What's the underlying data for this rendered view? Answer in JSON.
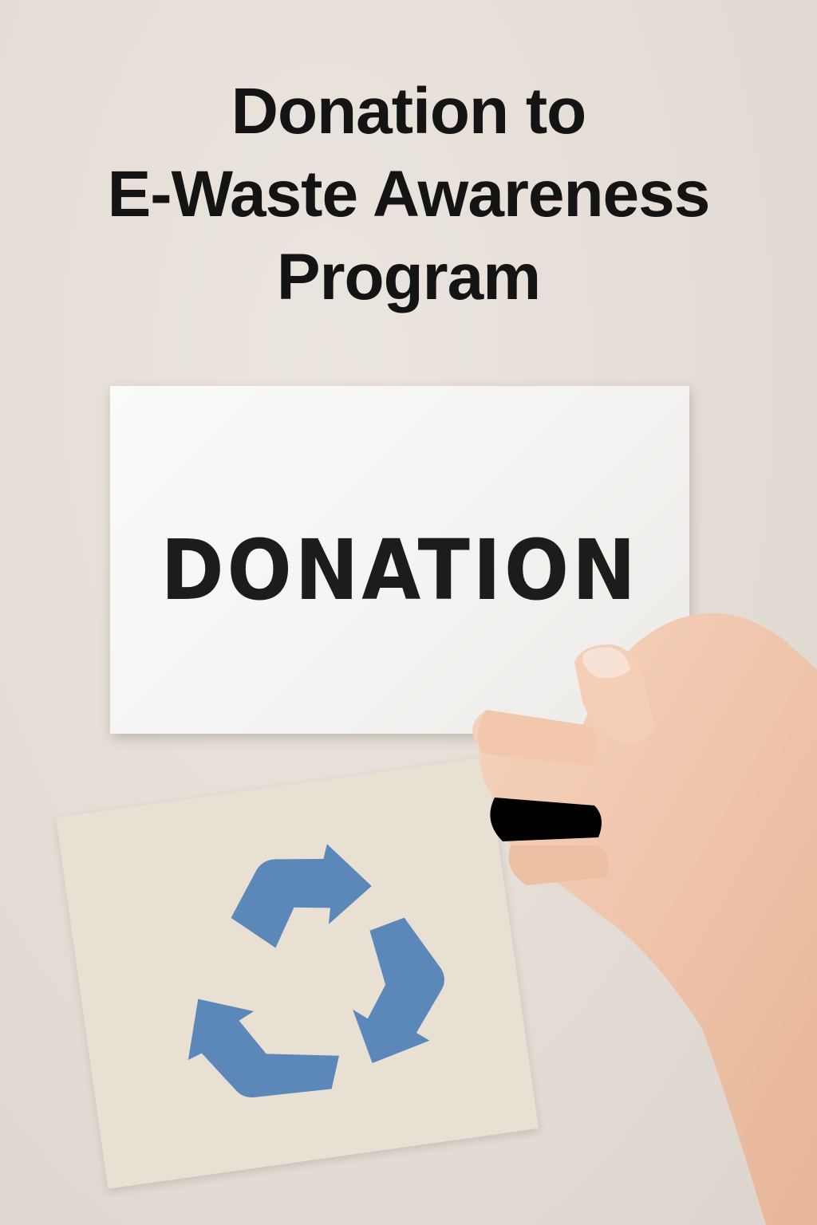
{
  "headline": {
    "lines": [
      "Donation to",
      "E-Waste Awareness",
      "Program"
    ]
  },
  "card": {
    "label": "DONATION"
  },
  "colors": {
    "background": "#e4ddd6",
    "headline_text": "#141414",
    "recycle_symbol": "#5b88b8",
    "recycle_card": "#e9e0d4",
    "donation_card": "#f6f5f3",
    "skin": "#f0c9b0"
  },
  "icons": {
    "recycle": "recycle-icon"
  }
}
